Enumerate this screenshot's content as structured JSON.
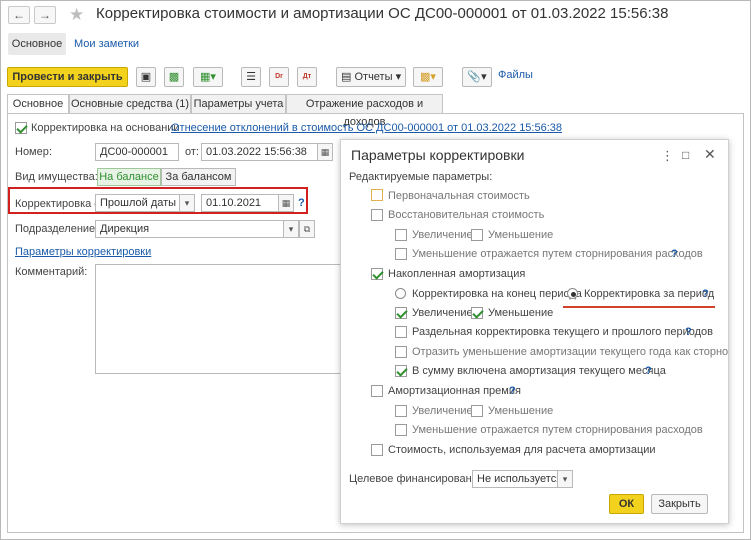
{
  "header": {
    "title": "Корректировка стоимости и амортизации ОС ДС00-000001 от 01.03.2022 15:56:38",
    "nav_tabs": [
      "Основное",
      "Мои заметки"
    ]
  },
  "toolbar": {
    "post_close": "Провести и закрыть",
    "reports": "Отчеты",
    "files": "Файлы"
  },
  "tabs": [
    "Основное",
    "Основные средства (1)",
    "Параметры учета",
    "Отражение расходов и доходов"
  ],
  "form": {
    "basis_checkbox": "Корректировка на основании",
    "basis_link": "Отнесение отклонений в стоимость ОС ДС00-000001 от 01.03.2022 15:56:38",
    "number_label": "Номер:",
    "number_value": "ДС00-000001",
    "from_label": "от:",
    "date_value": "01.03.2022 15:56:38",
    "ops_label": "Вид имущества:",
    "ops_on": "На балансе",
    "ops_off": "За балансом",
    "adj_label": "Корректировка с:",
    "adj_value": "Прошлой даты",
    "adj_date": "01.10.2021",
    "dept_label": "Подразделение:",
    "dept_value": "Дирекция",
    "params_link": "Параметры корректировки",
    "comment_label": "Комментарий:"
  },
  "dialog": {
    "title": "Параметры корректировки",
    "subtitle": "Редактируемые параметры:",
    "initial_cost": "Первоначальная стоимость",
    "restore_cost": "Восстановительная стоимость",
    "increase": "Увеличение",
    "decrease": "Уменьшение",
    "storno": "Уменьшение отражается путем сторнирования расходов",
    "accum": "Накопленная амортизация",
    "end_period": "Корректировка на конец периода",
    "for_period": "Корректировка за период",
    "separate": "Раздельная корректировка текущего и прошлого периодов",
    "storno_year": "Отразить уменьшение амортизации текущего года как сторно",
    "include_month": "В сумму включена амортизация текущего месяца",
    "premium": "Амортизационная премия",
    "cost_basis": "Стоимость, используемая для расчета амортизации",
    "funding_label": "Целевое финансирование:",
    "funding_value": "Не используется",
    "ok": "ОК",
    "close": "Закрыть",
    "q": "?"
  }
}
